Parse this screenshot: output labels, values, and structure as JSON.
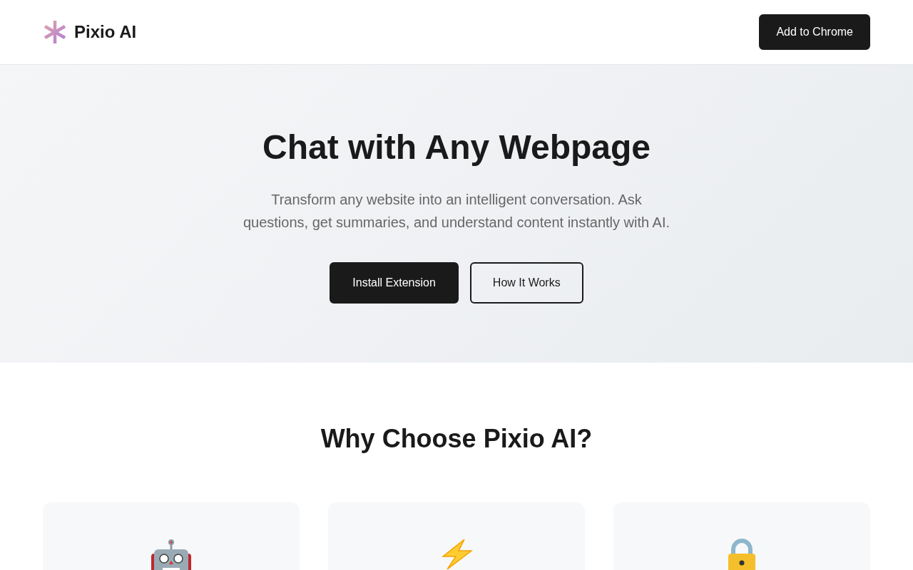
{
  "header": {
    "brand": "Pixio AI",
    "cta": "Add to Chrome"
  },
  "hero": {
    "title": "Chat with Any Webpage",
    "subtitle": "Transform any website into an intelligent conversation. Ask questions, get summaries, and understand content instantly with AI.",
    "buttons": [
      {
        "label": "Install Extension",
        "kind": "primary"
      },
      {
        "label": "How It Works",
        "kind": "secondary"
      }
    ]
  },
  "features": {
    "title": "Why Choose Pixio AI?",
    "cards": [
      {
        "kind": "robot"
      },
      {
        "kind": "bolt"
      },
      {
        "kind": "lock"
      }
    ]
  }
}
